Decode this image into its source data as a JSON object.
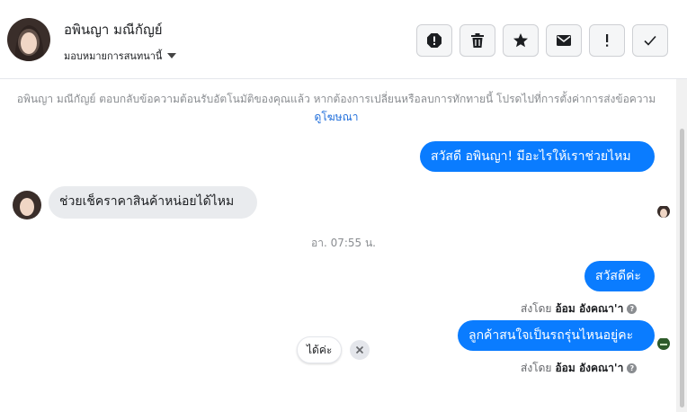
{
  "header": {
    "contact_name": "อพินญา มณีกัญย์",
    "assign_label": "มอบหมายการสนทนานี้"
  },
  "actions": [
    {
      "name": "report-spam-icon"
    },
    {
      "name": "trash-icon"
    },
    {
      "name": "star-icon"
    },
    {
      "name": "envelope-icon"
    },
    {
      "name": "exclamation-icon"
    },
    {
      "name": "checkmark-icon"
    }
  ],
  "notice": {
    "text": "อพินญา มณีกัญย์ ตอบกลับข้อความต้อนรับอัตโนมัติของคุณแล้ว หากต้องการเปลี่ยนหรือลบการทักทายนี้ โปรดไปที่การตั้งค่าการส่งข้อความ",
    "link": "ดูโฆษณา"
  },
  "messages": {
    "greeting": "สวัสดี อพินญา! มีอะไรให้เราช่วยไหม",
    "customer_question": "ช่วยเช็คราคาสินค้าหน่อยได้ไหม",
    "timestamp": "อา. 07:55 น.",
    "reply_1": "สวัสดีค่ะ",
    "reply_2": "ลูกค้าสนใจเป็นรถรุ่นไหนอยู่คะ",
    "sent_by_prefix": "ส่งโดย",
    "sent_by_name": "อ้อม อังคณา'า"
  },
  "quick_reply": {
    "label": "ได้ค่ะ"
  },
  "colors": {
    "outgoing_bubble": "#0a7cff",
    "incoming_bubble": "#e9ebee",
    "link": "#216fdb"
  }
}
